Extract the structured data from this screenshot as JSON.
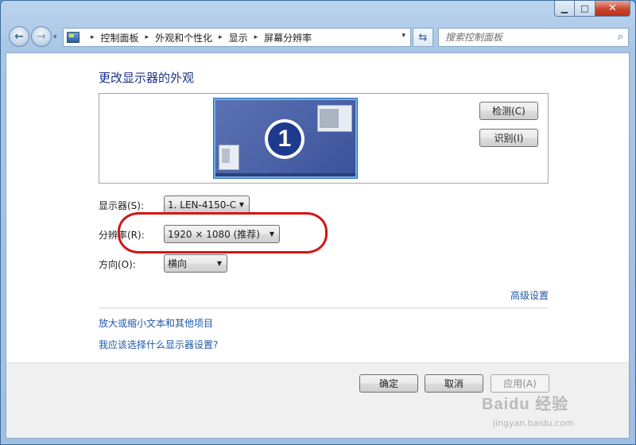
{
  "window": {
    "minimize_glyph": "▁",
    "maximize_glyph": "□",
    "close_glyph": "✕"
  },
  "nav": {
    "back_glyph": "←",
    "forward_glyph": "→",
    "recent_glyph": "▾",
    "breadcrumb": [
      "控制面板",
      "外观和个性化",
      "显示",
      "屏幕分辨率"
    ],
    "separator": "▸",
    "address_dropdown_glyph": "▾",
    "refresh_glyph": "⇆",
    "search_placeholder": "搜索控制面板",
    "search_icon_glyph": "⌕"
  },
  "main": {
    "title": "更改显示器的外观",
    "monitor_number": "1",
    "detect_button": "检测(C)",
    "identify_button": "识别(I)",
    "display_label": "显示器(S):",
    "display_value": "1. LEN-4150-C",
    "resolution_label": "分辨率(R):",
    "resolution_value": "1920 × 1080 (推荐)",
    "orientation_label": "方向(O):",
    "orientation_value": "横向",
    "dropdown_glyph": "▼",
    "advanced_link": "高级设置",
    "link_text_size": "放大或缩小文本和其他项目",
    "link_which_settings": "我应该选择什么显示器设置?"
  },
  "footer": {
    "ok": "确定",
    "cancel": "取消",
    "apply": "应用(A)"
  },
  "watermark": {
    "brand": "Baidu 经验",
    "url": "jingyan.baidu.com"
  },
  "colors": {
    "highlight_ring": "#d41515",
    "link": "#1f58a8",
    "title": "#1e3287"
  }
}
